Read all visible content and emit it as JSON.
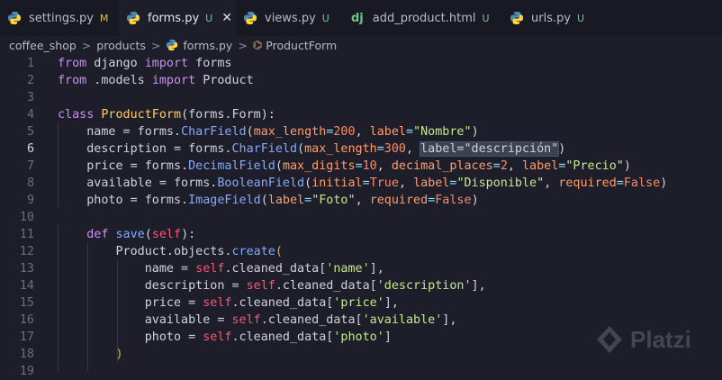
{
  "tabs": [
    {
      "label": "settings.py",
      "status": "M",
      "icon": "python-icon",
      "active": false
    },
    {
      "label": "forms.py",
      "status": "U",
      "icon": "python-icon",
      "active": true
    },
    {
      "label": "views.py",
      "status": "U",
      "icon": "python-icon",
      "active": false
    },
    {
      "label": "add_product.html",
      "status": "U",
      "icon": "django-icon",
      "active": false
    },
    {
      "label": "urls.py",
      "status": "U",
      "icon": "python-icon",
      "active": false
    }
  ],
  "close_glyph": "✕",
  "django_glyph": "dj",
  "breadcrumb": {
    "items": [
      "coffee_shop",
      "products",
      "forms.py",
      "ProductForm"
    ],
    "separator": ">"
  },
  "code_lines": [
    {
      "n": 1,
      "tokens": [
        [
          "kw",
          "from"
        ],
        [
          "t",
          " django "
        ],
        [
          "kw",
          "import"
        ],
        [
          "t",
          " forms"
        ]
      ]
    },
    {
      "n": 2,
      "tokens": [
        [
          "kw",
          "from"
        ],
        [
          "t",
          " .models "
        ],
        [
          "kw",
          "import"
        ],
        [
          "t",
          " Product"
        ]
      ]
    },
    {
      "n": 3,
      "tokens": []
    },
    {
      "n": 4,
      "tokens": [
        [
          "kw",
          "class"
        ],
        [
          "t",
          " "
        ],
        [
          "cls",
          "ProductForm"
        ],
        [
          "t",
          "(forms.Form):"
        ]
      ]
    },
    {
      "n": 5,
      "tokens": [
        [
          "t",
          "    name = forms."
        ],
        [
          "fn",
          "CharField"
        ],
        [
          "t",
          "("
        ],
        [
          "prm",
          "max_length"
        ],
        [
          "op",
          "="
        ],
        [
          "num",
          "200"
        ],
        [
          "t",
          ", "
        ],
        [
          "prm",
          "label"
        ],
        [
          "op",
          "="
        ],
        [
          "str",
          "\"Nombre\""
        ],
        [
          "t",
          ")"
        ]
      ]
    },
    {
      "n": 6,
      "tokens": [
        [
          "t",
          "    description = forms."
        ],
        [
          "fn",
          "CharField"
        ],
        [
          "t",
          "("
        ],
        [
          "prm",
          "max_length"
        ],
        [
          "op",
          "="
        ],
        [
          "num",
          "300"
        ],
        [
          "t",
          ", "
        ],
        [
          "sel",
          "label=\"descripción\""
        ],
        [
          "t",
          ")"
        ]
      ]
    },
    {
      "n": 7,
      "tokens": [
        [
          "t",
          "    price = forms."
        ],
        [
          "fn",
          "DecimalField"
        ],
        [
          "t",
          "("
        ],
        [
          "prm",
          "max_digits"
        ],
        [
          "op",
          "="
        ],
        [
          "num",
          "10"
        ],
        [
          "t",
          ", "
        ],
        [
          "prm",
          "decimal_places"
        ],
        [
          "op",
          "="
        ],
        [
          "num",
          "2"
        ],
        [
          "t",
          ", "
        ],
        [
          "prm",
          "label"
        ],
        [
          "op",
          "="
        ],
        [
          "str",
          "\"Precio\""
        ],
        [
          "t",
          ")"
        ]
      ]
    },
    {
      "n": 8,
      "tokens": [
        [
          "t",
          "    available = forms."
        ],
        [
          "fn",
          "BooleanField"
        ],
        [
          "t",
          "("
        ],
        [
          "prm",
          "initial"
        ],
        [
          "op",
          "="
        ],
        [
          "num",
          "True"
        ],
        [
          "t",
          ", "
        ],
        [
          "prm",
          "label"
        ],
        [
          "op",
          "="
        ],
        [
          "str",
          "\"Disponible\""
        ],
        [
          "t",
          ", "
        ],
        [
          "prm",
          "required"
        ],
        [
          "op",
          "="
        ],
        [
          "num",
          "False"
        ],
        [
          "t",
          ")"
        ]
      ]
    },
    {
      "n": 9,
      "tokens": [
        [
          "t",
          "    photo = forms."
        ],
        [
          "fn",
          "ImageField"
        ],
        [
          "t",
          "("
        ],
        [
          "prm",
          "label"
        ],
        [
          "op",
          "="
        ],
        [
          "str",
          "\"Foto\""
        ],
        [
          "t",
          ", "
        ],
        [
          "prm",
          "required"
        ],
        [
          "op",
          "="
        ],
        [
          "num",
          "False"
        ],
        [
          "t",
          ")"
        ]
      ]
    },
    {
      "n": 10,
      "tokens": []
    },
    {
      "n": 11,
      "tokens": [
        [
          "t",
          "    "
        ],
        [
          "kw",
          "def"
        ],
        [
          "t",
          " "
        ],
        [
          "fn",
          "save"
        ],
        [
          "t",
          "("
        ],
        [
          "slf",
          "self"
        ],
        [
          "t",
          "):"
        ]
      ]
    },
    {
      "n": 12,
      "tokens": [
        [
          "t",
          "        Product.objects."
        ],
        [
          "fn",
          "create"
        ],
        [
          "pn",
          "("
        ]
      ]
    },
    {
      "n": 13,
      "tokens": [
        [
          "t",
          "            name = "
        ],
        [
          "slf",
          "self"
        ],
        [
          "t",
          ".cleaned_data["
        ],
        [
          "str",
          "'name'"
        ],
        [
          "t",
          "],"
        ]
      ]
    },
    {
      "n": 14,
      "tokens": [
        [
          "t",
          "            description = "
        ],
        [
          "slf",
          "self"
        ],
        [
          "t",
          ".cleaned_data["
        ],
        [
          "str",
          "'description'"
        ],
        [
          "t",
          "],"
        ]
      ]
    },
    {
      "n": 15,
      "tokens": [
        [
          "t",
          "            price = "
        ],
        [
          "slf",
          "self"
        ],
        [
          "t",
          ".cleaned_data["
        ],
        [
          "str",
          "'price'"
        ],
        [
          "t",
          "],"
        ]
      ]
    },
    {
      "n": 16,
      "tokens": [
        [
          "t",
          "            available = "
        ],
        [
          "slf",
          "self"
        ],
        [
          "t",
          ".cleaned_data["
        ],
        [
          "str",
          "'available'"
        ],
        [
          "t",
          "],"
        ]
      ]
    },
    {
      "n": 17,
      "tokens": [
        [
          "t",
          "            photo = "
        ],
        [
          "slf",
          "self"
        ],
        [
          "t",
          ".cleaned_data["
        ],
        [
          "str",
          "'photo'"
        ],
        [
          "t",
          "]"
        ]
      ]
    },
    {
      "n": 18,
      "tokens": [
        [
          "t",
          "        "
        ],
        [
          "pn",
          ")"
        ]
      ]
    },
    {
      "n": 19,
      "tokens": []
    }
  ],
  "current_line": 6,
  "watermark": {
    "text": "Platzi",
    "icon": "platzi-logo-icon"
  },
  "colors": {
    "background": "#1e1e2a",
    "tabbar": "#191923",
    "keyword": "#c792ea",
    "string": "#c3e88d"
  }
}
